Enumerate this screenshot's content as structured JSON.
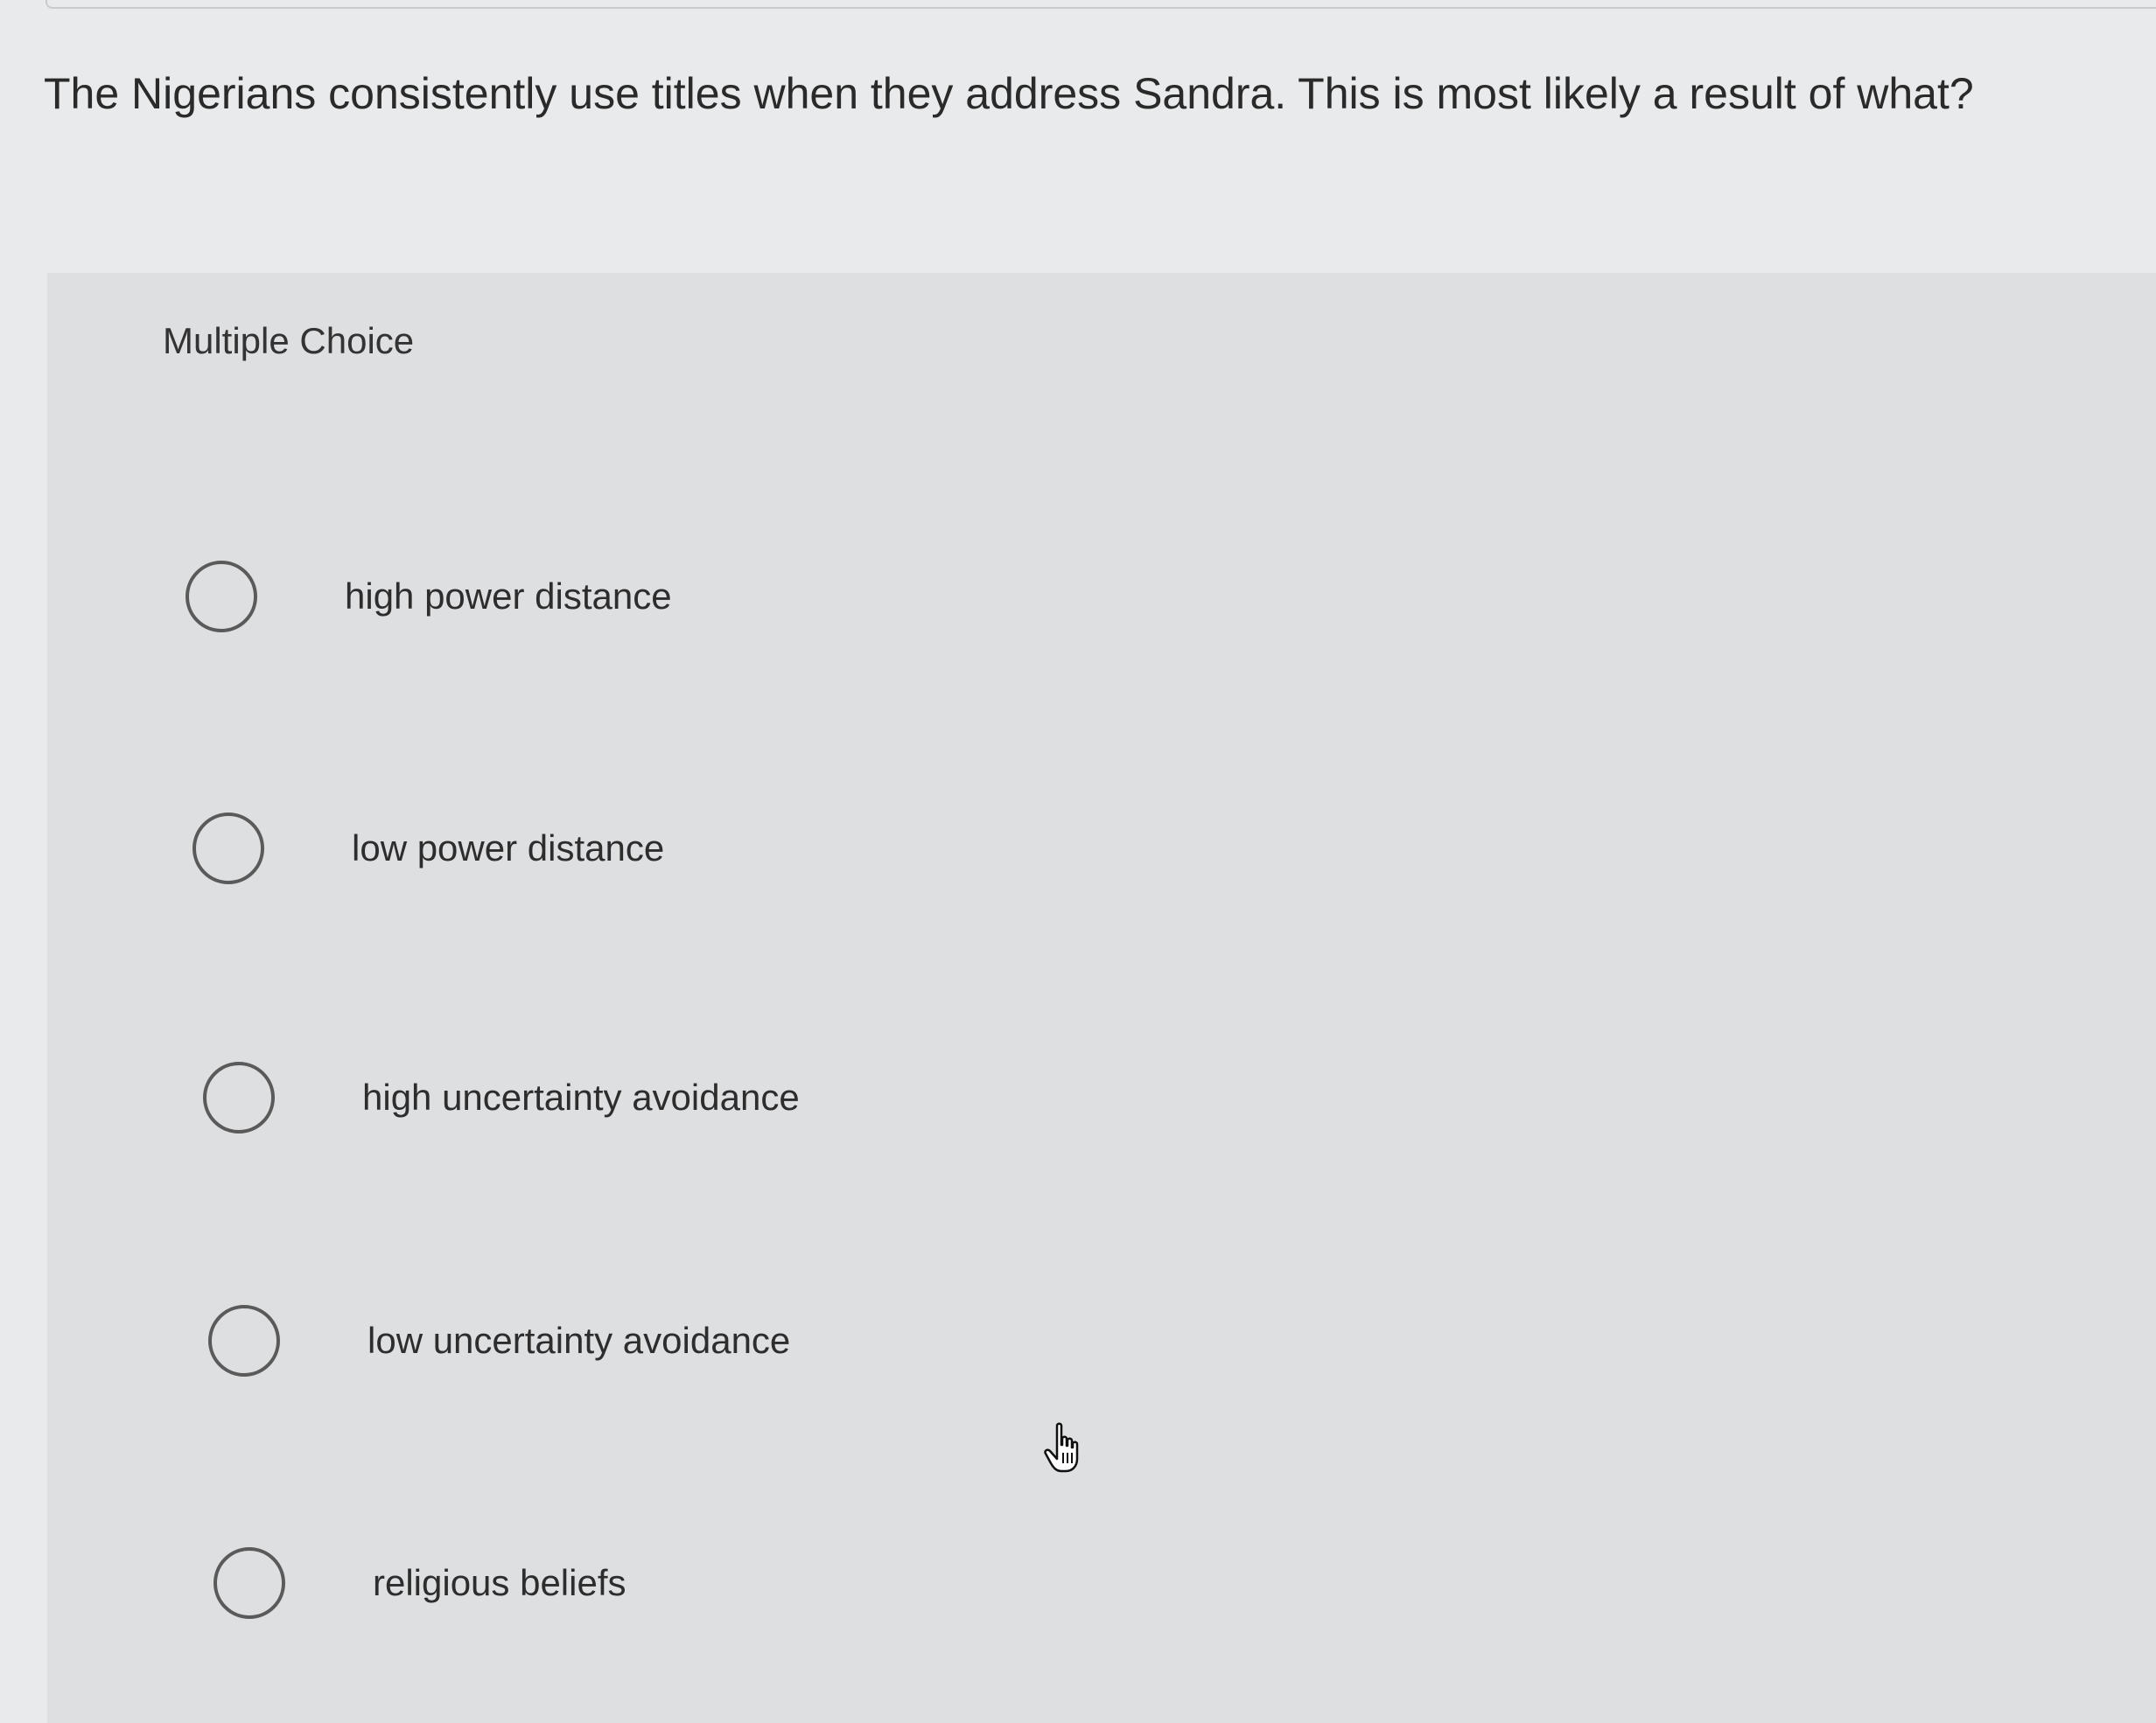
{
  "question": {
    "text": "The Nigerians consistently use titles when they address Sandra. This is most likely a result of what?"
  },
  "panel": {
    "label": "Multiple Choice",
    "options": [
      {
        "label": "high power distance",
        "selected": false
      },
      {
        "label": "low power distance",
        "selected": false
      },
      {
        "label": "high uncertainty avoidance",
        "selected": false
      },
      {
        "label": "low uncertainty avoidance",
        "selected": false
      },
      {
        "label": "religious beliefs",
        "selected": false
      }
    ]
  },
  "cursor": {
    "icon": "hand-pointer-icon"
  },
  "colors": {
    "page_background": "#e9eaeb",
    "panel_background": "#dedfe1",
    "text": "#2b2b2b",
    "radio_border": "#5a5a5a"
  }
}
